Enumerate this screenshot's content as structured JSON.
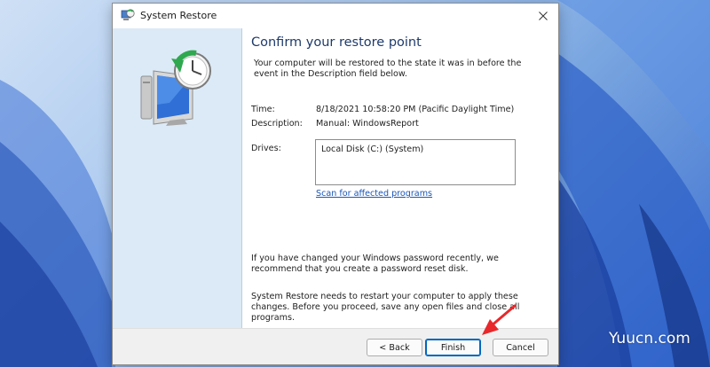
{
  "window": {
    "title": "System Restore",
    "close_icon": "close-icon"
  },
  "content": {
    "heading": "Confirm your restore point",
    "intro": "Your computer will be restored to the state it was in before the event in the Description field below.",
    "time_label": "Time:",
    "time_value": "8/18/2021 10:58:20 PM (Pacific Daylight Time)",
    "description_label": "Description:",
    "description_value": "Manual: WindowsReport",
    "drives_label": "Drives:",
    "drives_items": [
      "Local Disk (C:) (System)"
    ],
    "scan_link": "Scan for affected programs",
    "password_notice": "If you have changed your Windows password recently, we recommend that you create a password reset disk.",
    "restart_notice": "System Restore needs to restart your computer to apply these changes. Before you proceed, save any open files and close all programs."
  },
  "buttons": {
    "back": "< Back",
    "finish": "Finish",
    "cancel": "Cancel"
  },
  "watermark": "Yuucn.com",
  "colors": {
    "heading": "#1e3a6b",
    "link": "#1a56b8",
    "side_panel": "#dceaf7",
    "arrow": "#e8282b",
    "accent": "#0067c0"
  }
}
